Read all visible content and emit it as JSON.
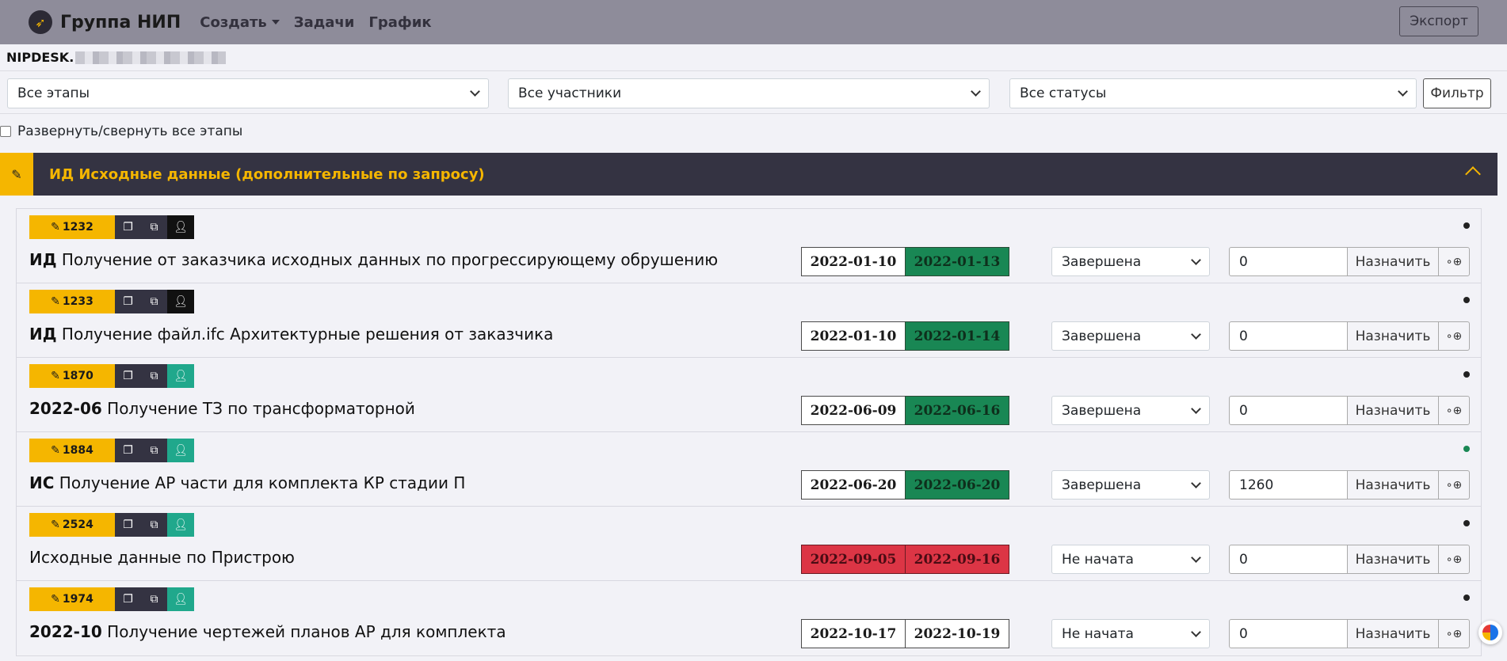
{
  "navbar": {
    "brand": "Группа НИП",
    "links": [
      {
        "label": "Создать",
        "dropdown": true
      },
      {
        "label": "Задачи",
        "dropdown": false
      },
      {
        "label": "График",
        "dropdown": false
      }
    ],
    "export_label": "Экспорт"
  },
  "project": {
    "code": "NIPDESK."
  },
  "filters": {
    "stages": "Все этапы",
    "participants": "Все участники",
    "statuses": "Все статусы",
    "filter_label": "Фильтр"
  },
  "toggle_all_label": "Развернуть/свернуть все этапы",
  "stage": {
    "title": "ИД Исходные данные (дополнительные по запросу)"
  },
  "assign_label": "Назначить",
  "tasks": [
    {
      "id": "1232",
      "prefix": "ИД",
      "title": "Получение от заказчика исходных данных по прогрессирующему обрушению",
      "start": "2022-01-10",
      "end": "2022-01-13",
      "date_state": "green",
      "status": "Завершена",
      "hours": "0",
      "user_color": "black",
      "dot": "dark"
    },
    {
      "id": "1233",
      "prefix": "ИД",
      "title": "Получение файл.ifc Архитектурные решения от заказчика",
      "start": "2022-01-10",
      "end": "2022-01-14",
      "date_state": "green",
      "status": "Завершена",
      "hours": "0",
      "user_color": "black",
      "dot": "dark"
    },
    {
      "id": "1870",
      "prefix": "2022-06",
      "title": "Получение ТЗ по трансформаторной",
      "start": "2022-06-09",
      "end": "2022-06-16",
      "date_state": "green",
      "status": "Завершена",
      "hours": "0",
      "user_color": "teal",
      "dot": "dark"
    },
    {
      "id": "1884",
      "prefix": "ИС",
      "title": "Получение АР части для комплекта КР стадии П",
      "start": "2022-06-20",
      "end": "2022-06-20",
      "date_state": "green",
      "status": "Завершена",
      "hours": "1260",
      "user_color": "teal",
      "dot": "green"
    },
    {
      "id": "2524",
      "prefix": "",
      "title": "Исходные данные по Пристрою",
      "start": "2022-09-05",
      "end": "2022-09-16",
      "date_state": "red",
      "status": "Не начата",
      "hours": "0",
      "user_color": "teal",
      "dot": "dark"
    },
    {
      "id": "1974",
      "prefix": "2022-10",
      "title": "Получение чертежей планов АР для комплекта",
      "start": "2022-10-17",
      "end": "2022-10-19",
      "date_state": "none",
      "status": "Не начата",
      "hours": "0",
      "user_color": "teal",
      "dot": "dark"
    }
  ],
  "icons": {
    "logo": "logo-icon",
    "edit": "pencil-icon",
    "copy": "copy-icon",
    "open": "external-link-icon",
    "user": "user-icon",
    "target": "target-icon",
    "collapse": "chevron-up-icon"
  },
  "colors": {
    "accent": "#f5b600",
    "header": "#343342",
    "navbar": "#8e8c9a",
    "success": "#198754",
    "danger": "#dc3545",
    "teal": "#20a88c"
  }
}
